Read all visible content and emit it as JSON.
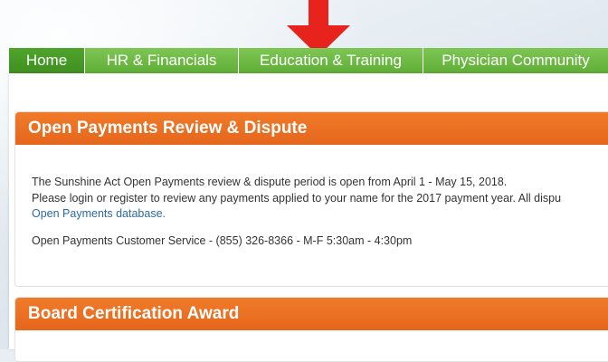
{
  "nav": {
    "tabs": [
      {
        "label": "Home"
      },
      {
        "label": "HR & Financials"
      },
      {
        "label": "Education & Training"
      },
      {
        "label": "Physician Community"
      }
    ]
  },
  "panels": {
    "open_payments": {
      "title": "Open Payments Review & Dispute",
      "line1": "The Sunshine Act Open Payments review & dispute period is open from April 1 - May 15, 2018.",
      "line2": "Please login or register to review any payments applied to your name for the 2017 payment year.  All dispu",
      "link": "Open Payments database.",
      "service": "Open Payments Customer Service - (855) 326-8366 - M-F 5:30am - 4:30pm"
    },
    "board_cert": {
      "title": "Board Certification Award"
    }
  },
  "colors": {
    "nav_green": "#6cba45",
    "nav_active": "#4a9d28",
    "header_orange": "#ea6f22",
    "link_blue": "#2b6aa8",
    "arrow_red": "#e8221c"
  },
  "icons": {
    "pointer": "red-down-arrow-icon"
  }
}
